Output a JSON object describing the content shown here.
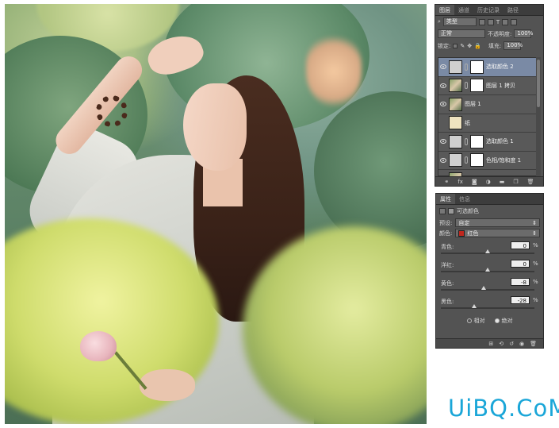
{
  "watermark": "UiBQ.CoM",
  "layers_panel": {
    "tabs": [
      "图层",
      "通道",
      "历史记录",
      "路径"
    ],
    "active_tab": 0,
    "filter_kind": "类型",
    "blend_mode": "正常",
    "opacity_label": "不透明度:",
    "opacity_value": "100%",
    "lock_label": "锁定:",
    "fill_label": "填充:",
    "fill_value": "100%",
    "layers": [
      {
        "name": "选取颜色 2",
        "thumb": "adjustment",
        "mask": true,
        "selected": true
      },
      {
        "name": "图层 1 拷贝",
        "thumb": "photo",
        "mask": true,
        "selected": false
      },
      {
        "name": "图层 1",
        "thumb": "photo",
        "mask": false,
        "selected": false
      },
      {
        "name": "纸",
        "thumb": "paper",
        "mask": false,
        "selected": false
      },
      {
        "name": "选取颜色 1",
        "thumb": "adjustment",
        "mask": true,
        "selected": false
      },
      {
        "name": "色相/饱和度 1",
        "thumb": "adjustment",
        "mask": true,
        "selected": false
      },
      {
        "name": "背景",
        "thumb": "photo",
        "mask": false,
        "selected": false,
        "locked": true
      }
    ],
    "footer_icons": [
      "link-icon",
      "fx-icon",
      "mask-icon",
      "adjustment-icon",
      "folder-icon",
      "new-layer-icon",
      "trash-icon"
    ]
  },
  "properties_panel": {
    "tabs": [
      "属性",
      "信息"
    ],
    "title": "可选颜色",
    "preset_label": "预设:",
    "preset_value": "自定",
    "colors_label": "颜色:",
    "colors_value": "红色",
    "colors_swatch": "#c0271e",
    "sliders": [
      {
        "label": "青色:",
        "value": "0",
        "unit": "%",
        "position": 0.5
      },
      {
        "label": "洋红:",
        "value": "0",
        "unit": "%",
        "position": 0.5
      },
      {
        "label": "黄色:",
        "value": "-8",
        "unit": "%",
        "position": 0.46
      },
      {
        "label": "黑色:",
        "value": "-28",
        "unit": "%",
        "position": 0.36
      }
    ],
    "method_relative": "相对",
    "method_absolute": "绝对",
    "method_selected": "绝对"
  }
}
